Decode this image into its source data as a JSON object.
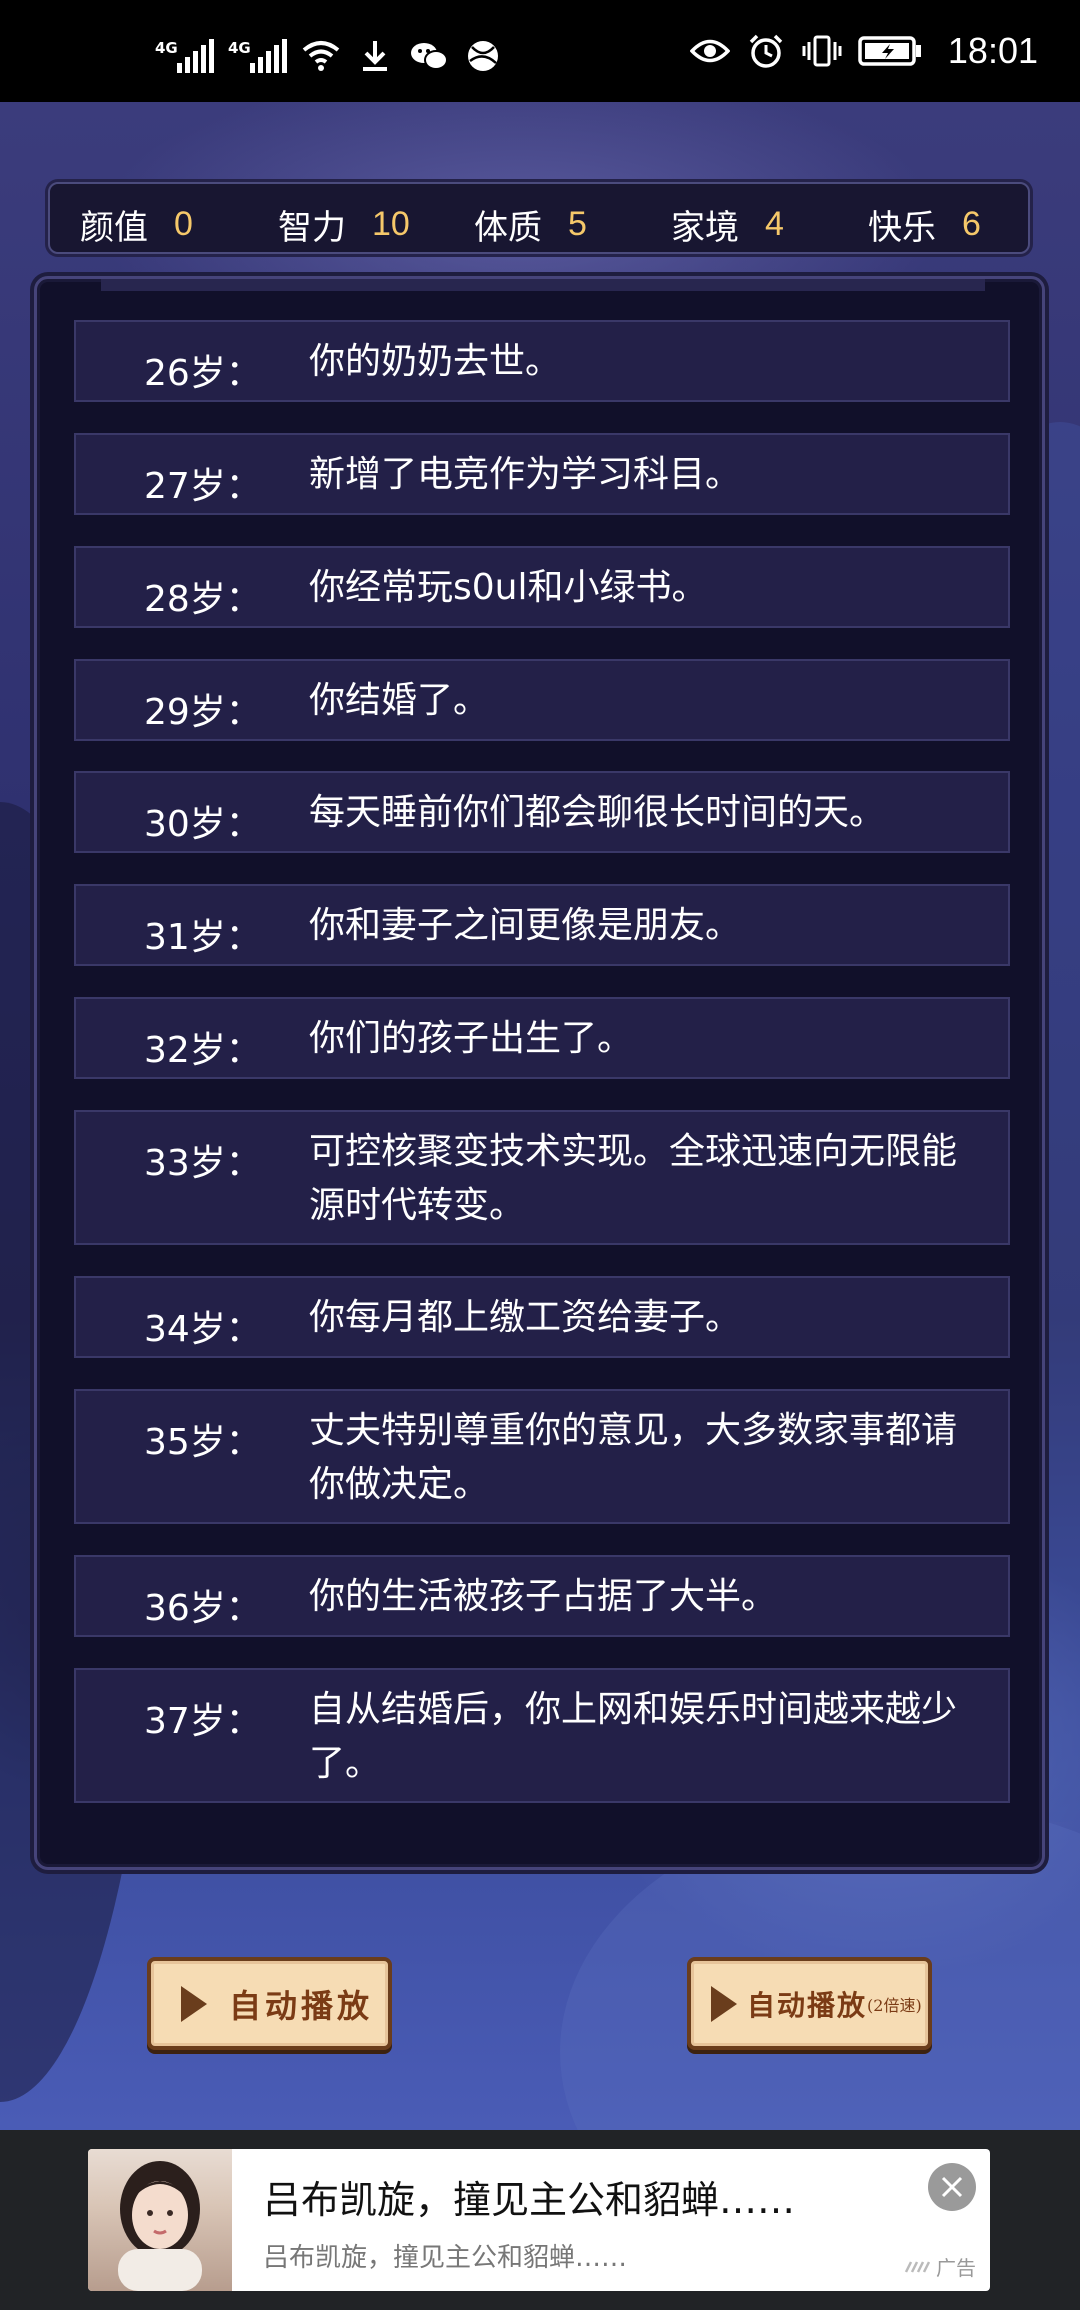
{
  "status_bar": {
    "net1": "4G",
    "net2": "4G",
    "time": "18:01"
  },
  "stats": [
    {
      "label": "颜值",
      "value": "0"
    },
    {
      "label": "智力",
      "value": "10"
    },
    {
      "label": "体质",
      "value": "5"
    },
    {
      "label": "家境",
      "value": "4"
    },
    {
      "label": "快乐",
      "value": "6"
    }
  ],
  "events": [
    {
      "age": "26岁：",
      "text": "你的奶奶去世。"
    },
    {
      "age": "27岁：",
      "text": "新增了电竞作为学习科目。"
    },
    {
      "age": "28岁：",
      "text": "你经常玩s0ul和小绿书。"
    },
    {
      "age": "29岁：",
      "text": "你结婚了。"
    },
    {
      "age": "30岁：",
      "text": "每天睡前你们都会聊很长时间的天。"
    },
    {
      "age": "31岁：",
      "text": "你和妻子之间更像是朋友。"
    },
    {
      "age": "32岁：",
      "text": "你们的孩子出生了。"
    },
    {
      "age": "33岁：",
      "text": "可控核聚变技术实现。全球迅速向无限能源时代转变。"
    },
    {
      "age": "34岁：",
      "text": "你每月都上缴工资给妻子。"
    },
    {
      "age": "35岁：",
      "text": "丈夫特别尊重你的意见，大多数家事都请你做决定。"
    },
    {
      "age": "36岁：",
      "text": "你的生活被孩子占据了大半。"
    },
    {
      "age": "37岁：",
      "text": "自从结婚后，你上网和娱乐时间越来越少了。"
    }
  ],
  "controls": {
    "auto_play": "自动播放",
    "auto_play_fast": "自动播放",
    "auto_play_fast_note": "(2倍速)"
  },
  "ad": {
    "title": "吕布凯旋，撞见主公和貂蝉……",
    "description": "吕布凯旋，撞见主公和貂蝉……",
    "badge": "广告"
  }
}
